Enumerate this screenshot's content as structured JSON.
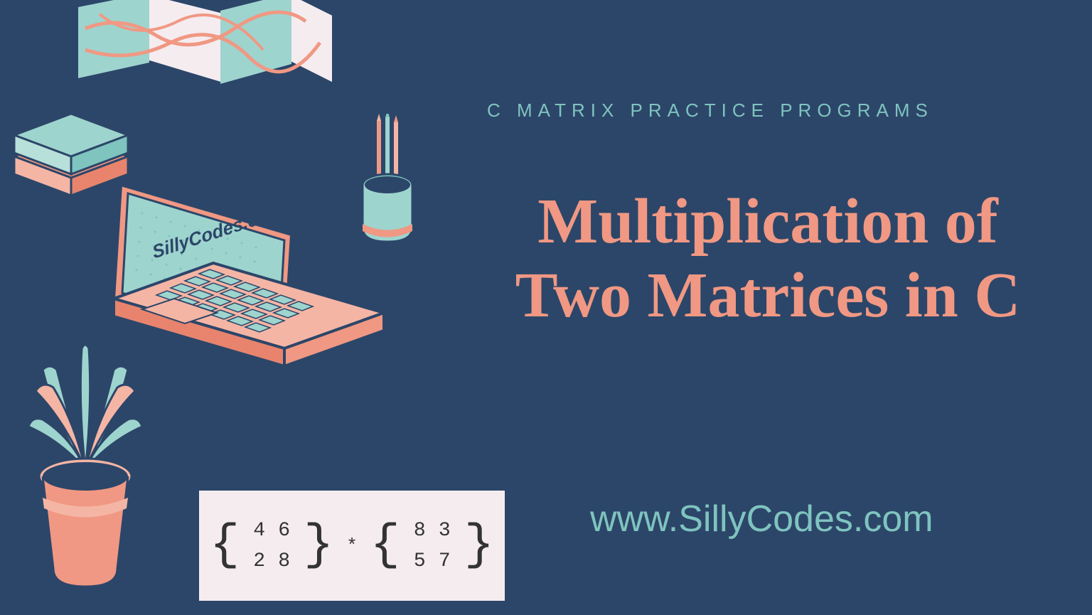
{
  "subtitle": "C MATRIX PRACTICE PROGRAMS",
  "title_line1": "Multiplication of",
  "title_line2": "Two Matrices in C",
  "website": "www.SillyCodes.com",
  "laptop_text": "SillyCodes.com",
  "matrix": {
    "a11": "4",
    "a12": "6",
    "a21": "2",
    "a22": "8",
    "b11": "8",
    "b12": "3",
    "b21": "5",
    "b22": "7",
    "op": "*"
  }
}
